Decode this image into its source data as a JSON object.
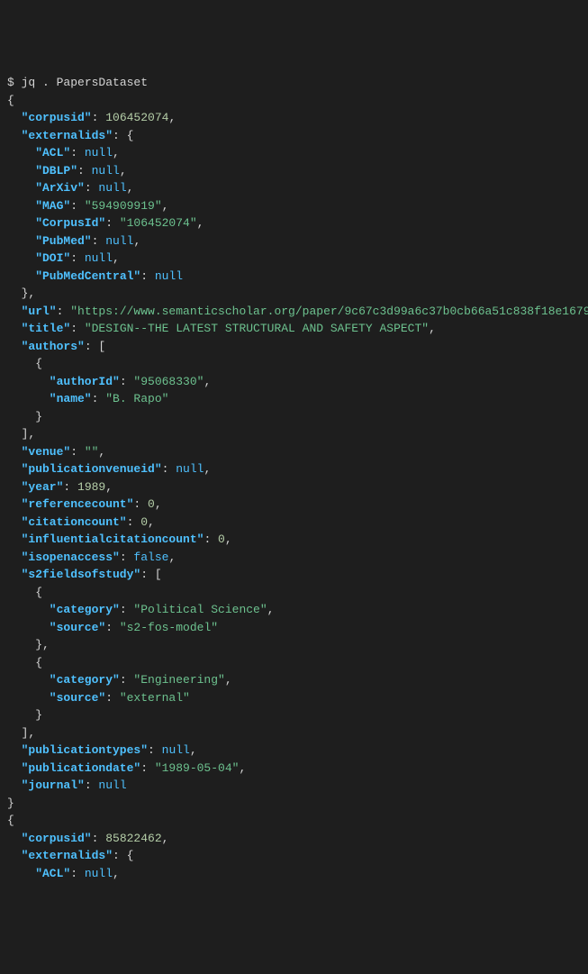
{
  "command": "$ jq . PapersDataset",
  "records": [
    {
      "corpusid": 106452074,
      "externalids": {
        "ACL": null,
        "DBLP": null,
        "ArXiv": null,
        "MAG": "594909919",
        "CorpusId": "106452074",
        "PubMed": null,
        "DOI": null,
        "PubMedCentral": null
      },
      "url": "https://www.semanticscholar.org/paper/9c67c3d99a6c37b0cb66a51c838f18e167991f49",
      "title": "DESIGN--THE LATEST STRUCTURAL AND SAFETY ASPECT",
      "authors": [
        {
          "authorId": "95068330",
          "name": "B. Rapo"
        }
      ],
      "venue": "",
      "publicationvenueid": null,
      "year": 1989,
      "referencecount": 0,
      "citationcount": 0,
      "influentialcitationcount": 0,
      "isopenaccess": false,
      "s2fieldsofstudy": [
        {
          "category": "Political Science",
          "source": "s2-fos-model"
        },
        {
          "category": "Engineering",
          "source": "external"
        }
      ],
      "publicationtypes": null,
      "publicationdate": "1989-05-04",
      "journal": null
    },
    {
      "corpusid": 85822462,
      "externalids": {
        "ACL": null
      }
    }
  ]
}
